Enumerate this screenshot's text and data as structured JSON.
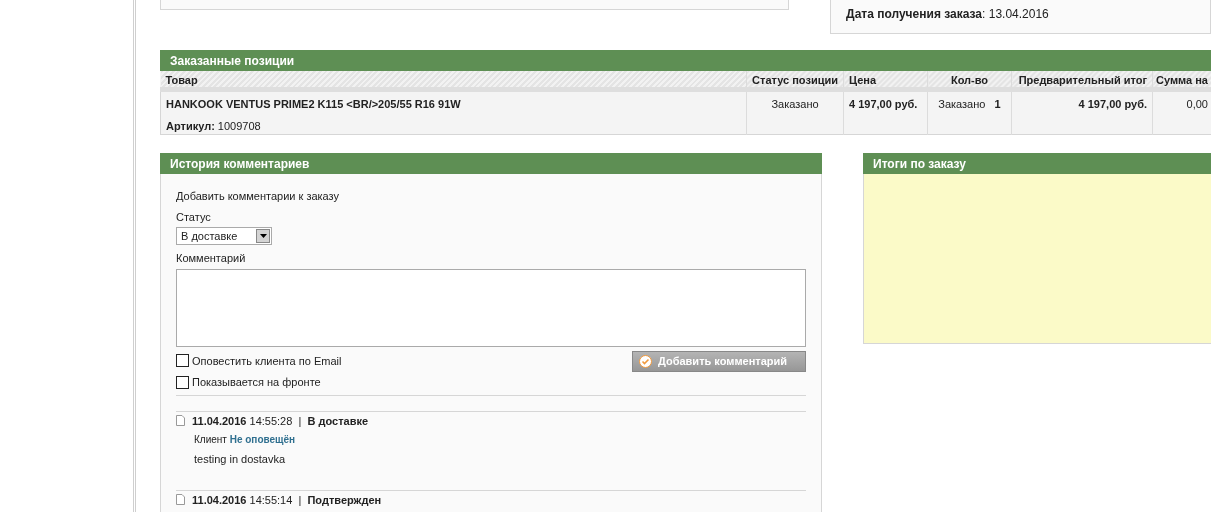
{
  "order_info": {
    "label": "Дата получения заказа",
    "separator": ":",
    "value": "13.04.2016"
  },
  "items_section": {
    "title": "Заказанные позиции",
    "columns": [
      "Товар",
      "Статус позиции",
      "Цена",
      "Кол-во",
      "Предварительный итог",
      "Сумма на"
    ],
    "rows": [
      {
        "name": "HANKOOK VENTUS PRIME2 K115 <BR/>205/55 R16 91W",
        "sku_label": "Артикул:",
        "sku": "1009708",
        "status": "Заказано",
        "price": "4 197,00 руб.",
        "qty_label": "Заказано",
        "qty": "1",
        "subtotal": "4 197,00 руб.",
        "column_6": "0,00"
      }
    ]
  },
  "history": {
    "title": "История комментариев",
    "form_title": "Добавить комментарии к заказу",
    "status_label": "Статус",
    "status_value": "В доставке",
    "comment_label": "Комментарий",
    "checkboxes": [
      {
        "label": "Оповестить клиента по Email",
        "checked": false
      },
      {
        "label": "Показывается на фронте",
        "checked": false
      }
    ],
    "submit": "Добавить комментарий",
    "entries": [
      {
        "date": "11.04.2016",
        "time": "14:55:28",
        "divider": "|",
        "status": "В доставке",
        "customer_label": "Клиент",
        "notified": "Не оповещён",
        "text": "testing in dostavka"
      },
      {
        "date": "11.04.2016",
        "time": "14:55:14",
        "divider": "|",
        "status": "Подтвержден"
      }
    ]
  },
  "totals": {
    "title": "Итоги по заказу"
  }
}
